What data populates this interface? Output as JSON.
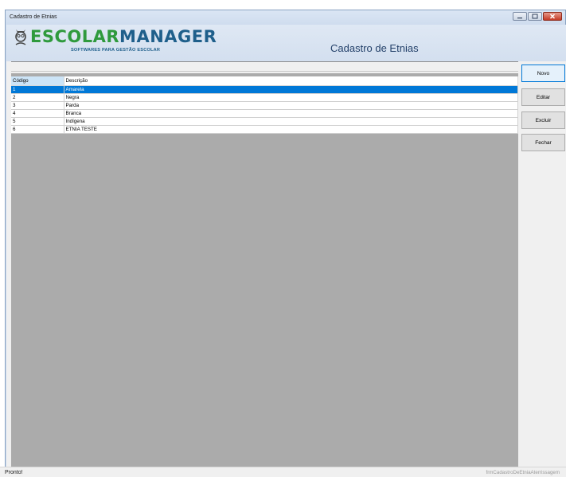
{
  "window": {
    "title": "Cadastro de Etnias",
    "controls": {
      "minimize_icon": "minimize-icon",
      "maximize_icon": "maximize-icon",
      "close_icon": "close-icon"
    }
  },
  "header": {
    "logo_word_a": "ESCOLAR",
    "logo_word_b": "MANAGER",
    "logo_tagline": "SOFTWARES PARA GESTÃO ESCOLAR",
    "form_title": "Cadastro de Etnias"
  },
  "grid": {
    "columns": [
      "Código",
      "Descrição"
    ],
    "selected_row": 0,
    "rows": [
      {
        "codigo": "1",
        "descricao": "Amarela"
      },
      {
        "codigo": "2",
        "descricao": "Negra"
      },
      {
        "codigo": "3",
        "descricao": "Parda"
      },
      {
        "codigo": "4",
        "descricao": "Branca"
      },
      {
        "codigo": "5",
        "descricao": "Indígena"
      },
      {
        "codigo": "6",
        "descricao": "ETNIA TESTE"
      }
    ]
  },
  "buttons": {
    "novo": "Novo",
    "editar": "Editar",
    "excluir": "Excluir",
    "fechar": "Fechar"
  },
  "status": {
    "left": "Pronto!",
    "right": "frmCadastroDeEtniaAterrissagem"
  },
  "colors": {
    "selection": "#0078d7",
    "grid_background": "#ababab",
    "logo_green": "#2f9a3d",
    "logo_blue": "#1f5f8b"
  }
}
